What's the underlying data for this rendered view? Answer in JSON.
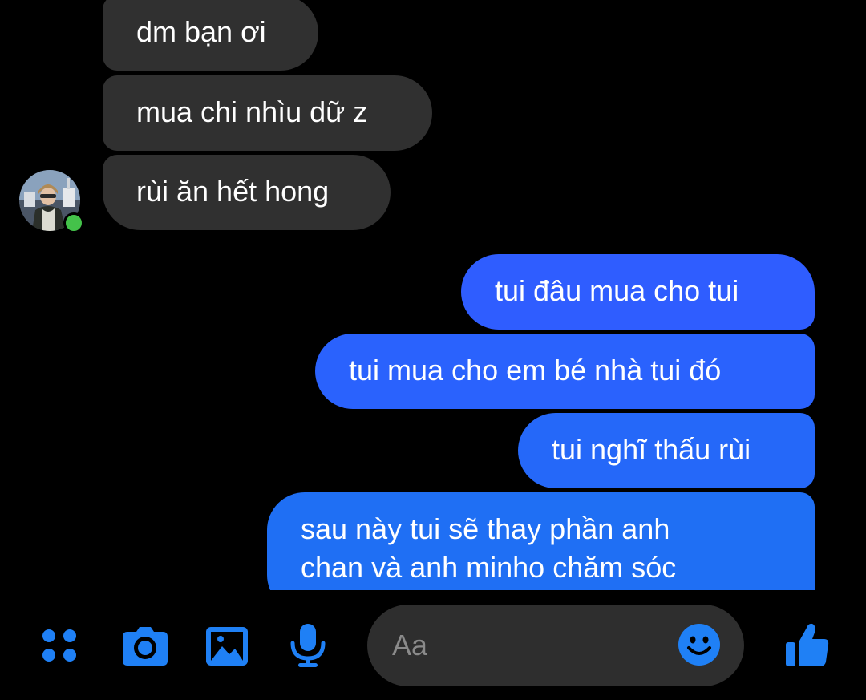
{
  "conversation": {
    "incoming": [
      {
        "text": "dm bạn ơi"
      },
      {
        "text": "mua chi nhìu dữ z"
      },
      {
        "text": "rùi ăn hết hong"
      }
    ],
    "outgoing": [
      {
        "text": "tui đâu mua cho tui"
      },
      {
        "text": "tui mua cho em bé nhà tui đó"
      },
      {
        "text": "tui nghĩ thấu rùi"
      },
      {
        "line1": "sau này tui sẽ thay phần anh",
        "line2": "chan và anh minho chăm sóc"
      }
    ],
    "contact_status": "online"
  },
  "composer": {
    "input_placeholder": "Aa",
    "icons": [
      "apps-icon",
      "camera-icon",
      "gallery-icon",
      "microphone-icon",
      "emoji-icon",
      "like-icon"
    ]
  },
  "colors": {
    "incoming_bubble": "#303030",
    "outgoing_gradient_top": "#2f5bff",
    "outgoing_gradient_bottom": "#1d6ff3",
    "accent_icon": "#1f80f5",
    "online": "#44c24a"
  }
}
